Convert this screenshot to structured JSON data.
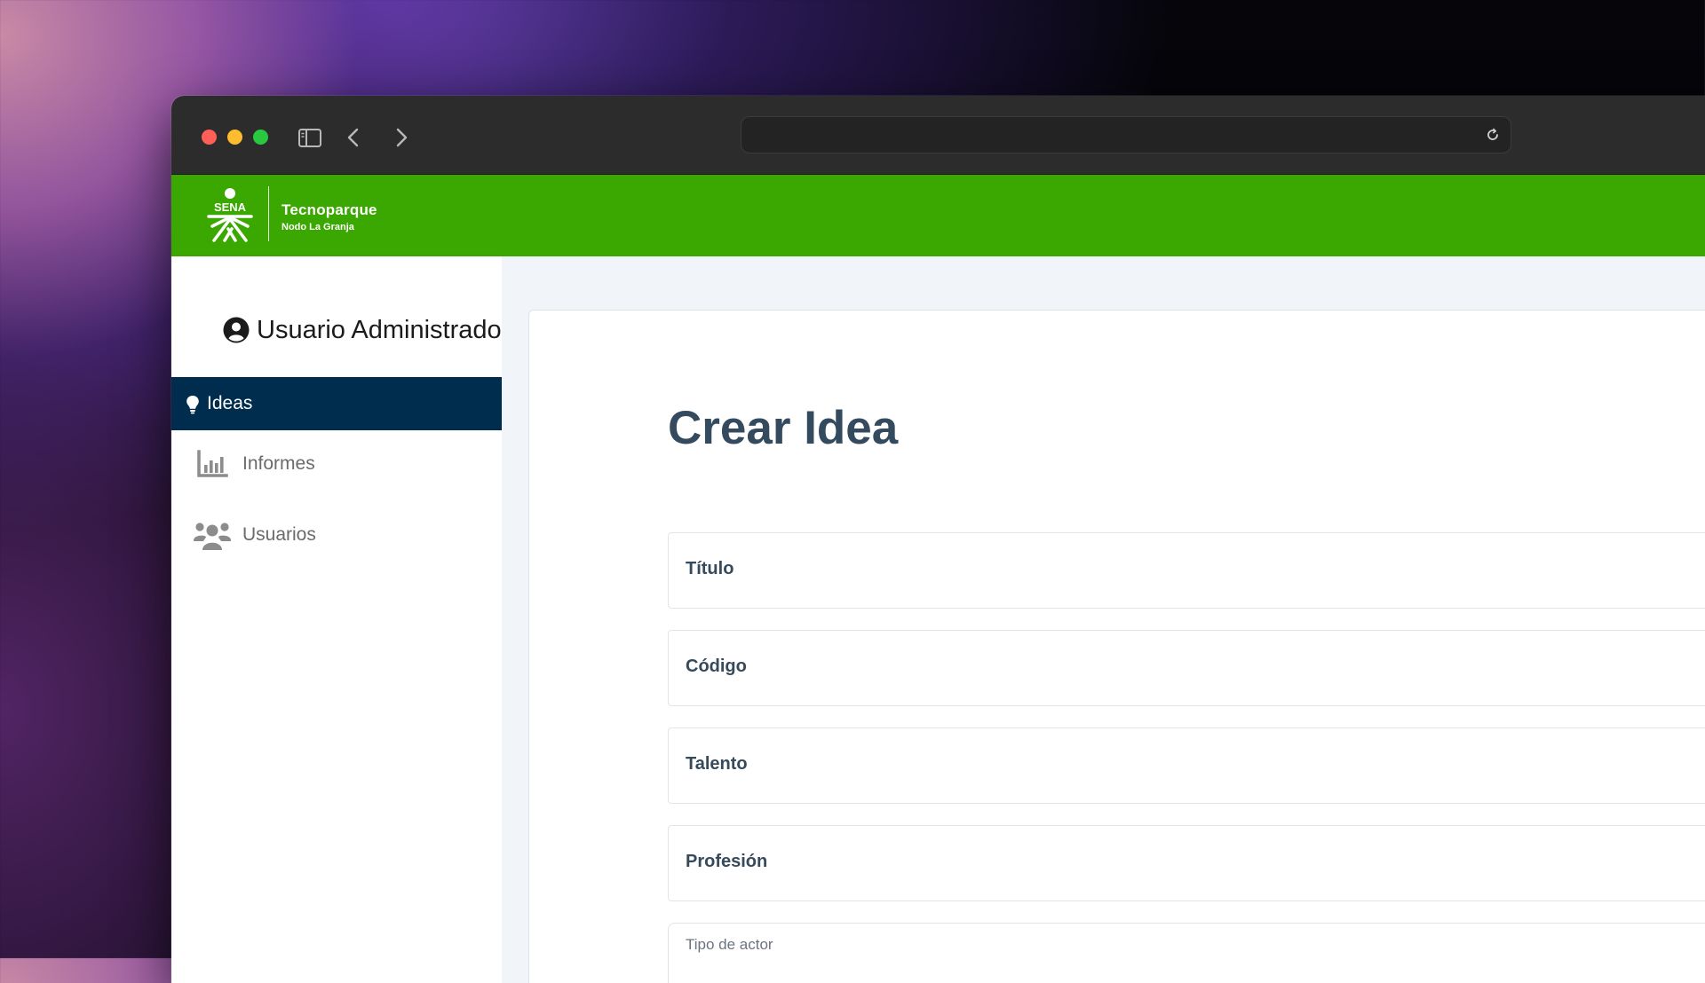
{
  "browser": {
    "address": ""
  },
  "header": {
    "logo_text": "SENA",
    "brand_title": "Tecnoparque",
    "brand_subtitle": "Nodo La Granja",
    "background_color": "#3ba802"
  },
  "sidebar": {
    "user_name": "Usuario Administrador",
    "items": [
      {
        "label": "Ideas",
        "icon": "lightbulb-icon",
        "active": true
      },
      {
        "label": "Informes",
        "icon": "bar-chart-icon",
        "active": false
      },
      {
        "label": "Usuarios",
        "icon": "users-icon",
        "active": false
      }
    ],
    "active_color": "#002c4e"
  },
  "main": {
    "title": "Crear Idea",
    "fields": [
      {
        "label": "Título",
        "value": ""
      },
      {
        "label": "Código",
        "value": ""
      },
      {
        "label": "Talento",
        "value": ""
      },
      {
        "label": "Profesión",
        "value": ""
      }
    ],
    "select": {
      "label": "Tipo de actor",
      "value": ""
    }
  }
}
